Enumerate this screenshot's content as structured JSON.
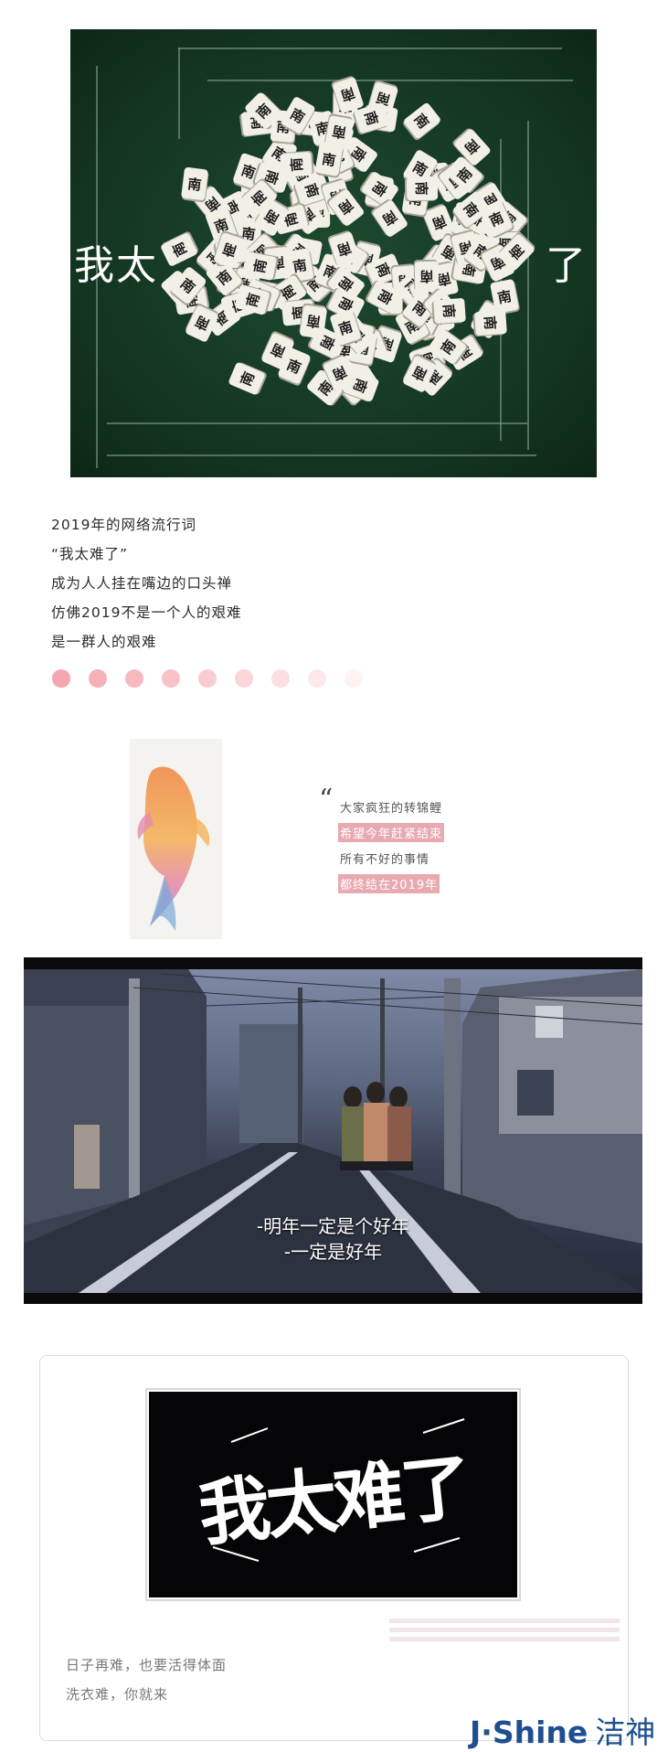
{
  "mahjong_image": {
    "overlay_left": "我太",
    "overlay_right": "了",
    "tile_glyph": "南"
  },
  "poem": {
    "lines": [
      "2019年的网络流行词",
      "“我太难了”",
      "成为人人挂在嘴边的口头禅",
      "仿佛2019不是一个人的艰难",
      "是一群人的艰难"
    ]
  },
  "dots": {
    "colors": [
      "#f5a6ae",
      "#f6b0b7",
      "#f7b9bf",
      "#f8c3c8",
      "#f9ccd1",
      "#fad6d9",
      "#fbdfe2",
      "#fde9eb",
      "#fef2f3"
    ]
  },
  "koi": {
    "quote_mark": "“",
    "lines": [
      {
        "text": "大家疯狂的转锦鲤",
        "highlight": false
      },
      {
        "text": "希望今年赶紧结束",
        "highlight": true
      },
      {
        "text": "所有不好的事情",
        "highlight": false
      },
      {
        "text": "都终结在2019年",
        "highlight": true
      }
    ]
  },
  "street_image": {
    "subtitle_1": "-明年一定是个好年",
    "subtitle_2": "-一定是好年"
  },
  "card": {
    "title_art": "我太难了",
    "line_1": "日子再难，也要活得体面",
    "line_2": "洗衣难，你就来"
  },
  "brand": {
    "latin": "J·Shine",
    "chinese": "洁神",
    "color": "#1f4f8f"
  }
}
